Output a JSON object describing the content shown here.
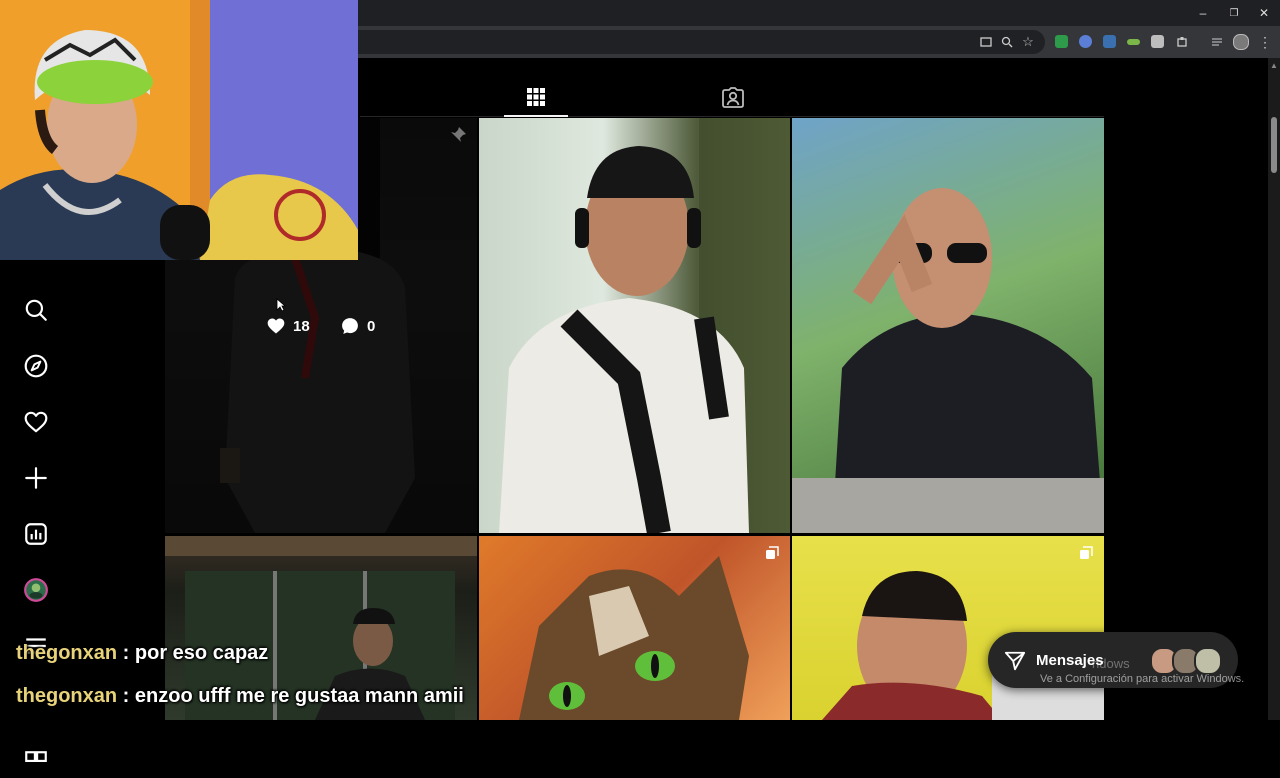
{
  "browser": {
    "window_controls": [
      "–",
      "❐",
      "✕"
    ]
  },
  "post_grid": {
    "hovered_post": {
      "likes": "18",
      "comments": "0"
    }
  },
  "chat": {
    "messages": [
      {
        "user": "thegonxan",
        "separator": " : ",
        "text": "por eso capaz"
      },
      {
        "user": "thegonxan",
        "separator": " : ",
        "text": "enzoo ufff me re gustaa mann amii"
      }
    ]
  },
  "messages_widget": {
    "label": "Mensajes"
  },
  "windows_activation": {
    "line1": "ndows",
    "line2": "Ve a Configuración para activar Windows."
  },
  "colors": {
    "chrome_bg": "#1f2023",
    "toolbar_bg": "#35363a",
    "page_bg": "#000000",
    "chat_user": "#e8d27a",
    "text": "#f5f5f5"
  },
  "icons": {
    "sidebar": [
      "search-icon",
      "explore-icon",
      "heart-icon",
      "create-icon",
      "dashboard-icon",
      "profile-avatar",
      "menu-icon",
      "threads-icon"
    ],
    "tabs": [
      "grid-icon",
      "tagged-icon"
    ]
  }
}
